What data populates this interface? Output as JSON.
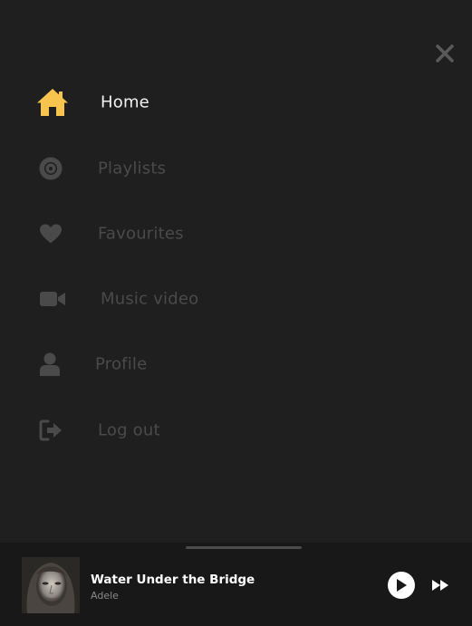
{
  "colors": {
    "background": "#1f1f1f",
    "player_background": "#181818",
    "active_icon": "#f7c54d",
    "inactive": "#4a4a4a",
    "active_text": "#f2f2f2"
  },
  "menu": {
    "close_icon": "close-icon",
    "items": [
      {
        "label": "Home",
        "icon": "home-icon",
        "active": true
      },
      {
        "label": "Playlists",
        "icon": "disc-icon",
        "active": false
      },
      {
        "label": "Favourites",
        "icon": "heart-icon",
        "active": false
      },
      {
        "label": "Music video",
        "icon": "video-camera-icon",
        "active": false
      },
      {
        "label": "Profile",
        "icon": "user-icon",
        "active": false
      },
      {
        "label": "Log out",
        "icon": "logout-icon",
        "active": false
      }
    ]
  },
  "player": {
    "track_title": "Water Under the Bridge",
    "artist": "Adele",
    "play_icon": "play-icon",
    "next_icon": "fast-forward-icon"
  }
}
